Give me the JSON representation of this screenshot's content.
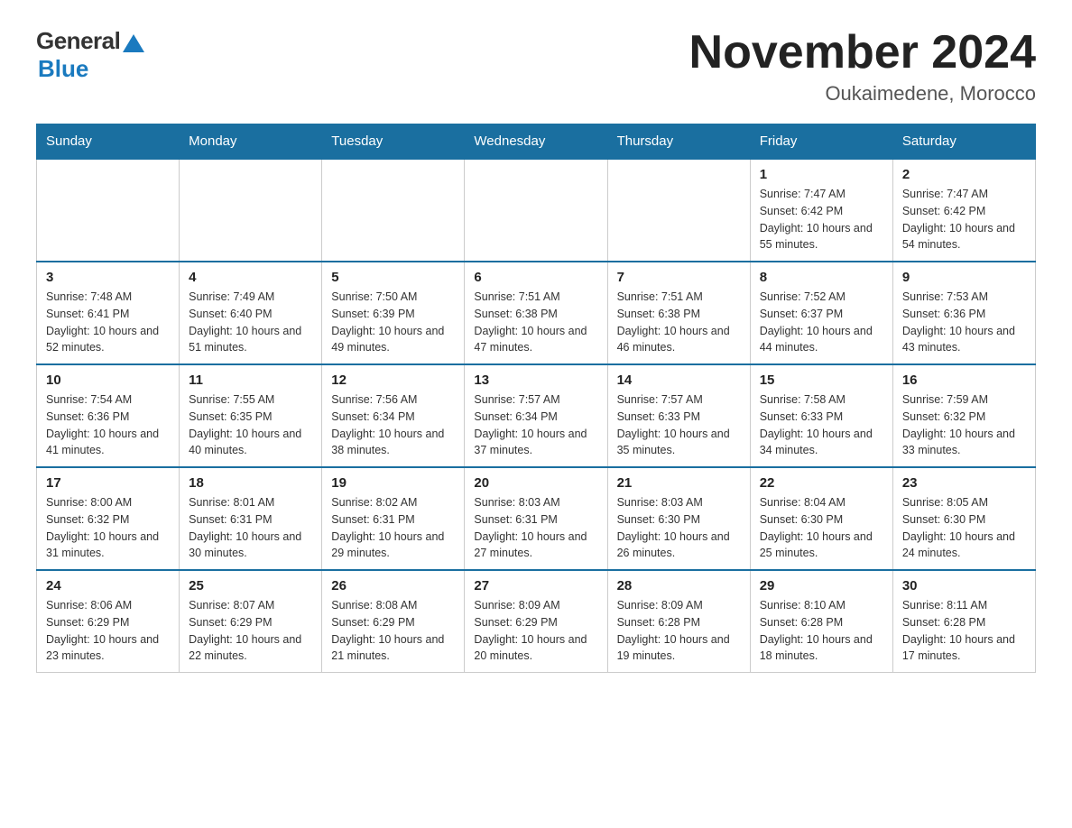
{
  "header": {
    "logo_general": "General",
    "logo_blue": "Blue",
    "month_title": "November 2024",
    "location": "Oukaimedene, Morocco"
  },
  "weekdays": [
    "Sunday",
    "Monday",
    "Tuesday",
    "Wednesday",
    "Thursday",
    "Friday",
    "Saturday"
  ],
  "weeks": [
    [
      {
        "day": "",
        "info": ""
      },
      {
        "day": "",
        "info": ""
      },
      {
        "day": "",
        "info": ""
      },
      {
        "day": "",
        "info": ""
      },
      {
        "day": "",
        "info": ""
      },
      {
        "day": "1",
        "info": "Sunrise: 7:47 AM\nSunset: 6:42 PM\nDaylight: 10 hours and 55 minutes."
      },
      {
        "day": "2",
        "info": "Sunrise: 7:47 AM\nSunset: 6:42 PM\nDaylight: 10 hours and 54 minutes."
      }
    ],
    [
      {
        "day": "3",
        "info": "Sunrise: 7:48 AM\nSunset: 6:41 PM\nDaylight: 10 hours and 52 minutes."
      },
      {
        "day": "4",
        "info": "Sunrise: 7:49 AM\nSunset: 6:40 PM\nDaylight: 10 hours and 51 minutes."
      },
      {
        "day": "5",
        "info": "Sunrise: 7:50 AM\nSunset: 6:39 PM\nDaylight: 10 hours and 49 minutes."
      },
      {
        "day": "6",
        "info": "Sunrise: 7:51 AM\nSunset: 6:38 PM\nDaylight: 10 hours and 47 minutes."
      },
      {
        "day": "7",
        "info": "Sunrise: 7:51 AM\nSunset: 6:38 PM\nDaylight: 10 hours and 46 minutes."
      },
      {
        "day": "8",
        "info": "Sunrise: 7:52 AM\nSunset: 6:37 PM\nDaylight: 10 hours and 44 minutes."
      },
      {
        "day": "9",
        "info": "Sunrise: 7:53 AM\nSunset: 6:36 PM\nDaylight: 10 hours and 43 minutes."
      }
    ],
    [
      {
        "day": "10",
        "info": "Sunrise: 7:54 AM\nSunset: 6:36 PM\nDaylight: 10 hours and 41 minutes."
      },
      {
        "day": "11",
        "info": "Sunrise: 7:55 AM\nSunset: 6:35 PM\nDaylight: 10 hours and 40 minutes."
      },
      {
        "day": "12",
        "info": "Sunrise: 7:56 AM\nSunset: 6:34 PM\nDaylight: 10 hours and 38 minutes."
      },
      {
        "day": "13",
        "info": "Sunrise: 7:57 AM\nSunset: 6:34 PM\nDaylight: 10 hours and 37 minutes."
      },
      {
        "day": "14",
        "info": "Sunrise: 7:57 AM\nSunset: 6:33 PM\nDaylight: 10 hours and 35 minutes."
      },
      {
        "day": "15",
        "info": "Sunrise: 7:58 AM\nSunset: 6:33 PM\nDaylight: 10 hours and 34 minutes."
      },
      {
        "day": "16",
        "info": "Sunrise: 7:59 AM\nSunset: 6:32 PM\nDaylight: 10 hours and 33 minutes."
      }
    ],
    [
      {
        "day": "17",
        "info": "Sunrise: 8:00 AM\nSunset: 6:32 PM\nDaylight: 10 hours and 31 minutes."
      },
      {
        "day": "18",
        "info": "Sunrise: 8:01 AM\nSunset: 6:31 PM\nDaylight: 10 hours and 30 minutes."
      },
      {
        "day": "19",
        "info": "Sunrise: 8:02 AM\nSunset: 6:31 PM\nDaylight: 10 hours and 29 minutes."
      },
      {
        "day": "20",
        "info": "Sunrise: 8:03 AM\nSunset: 6:31 PM\nDaylight: 10 hours and 27 minutes."
      },
      {
        "day": "21",
        "info": "Sunrise: 8:03 AM\nSunset: 6:30 PM\nDaylight: 10 hours and 26 minutes."
      },
      {
        "day": "22",
        "info": "Sunrise: 8:04 AM\nSunset: 6:30 PM\nDaylight: 10 hours and 25 minutes."
      },
      {
        "day": "23",
        "info": "Sunrise: 8:05 AM\nSunset: 6:30 PM\nDaylight: 10 hours and 24 minutes."
      }
    ],
    [
      {
        "day": "24",
        "info": "Sunrise: 8:06 AM\nSunset: 6:29 PM\nDaylight: 10 hours and 23 minutes."
      },
      {
        "day": "25",
        "info": "Sunrise: 8:07 AM\nSunset: 6:29 PM\nDaylight: 10 hours and 22 minutes."
      },
      {
        "day": "26",
        "info": "Sunrise: 8:08 AM\nSunset: 6:29 PM\nDaylight: 10 hours and 21 minutes."
      },
      {
        "day": "27",
        "info": "Sunrise: 8:09 AM\nSunset: 6:29 PM\nDaylight: 10 hours and 20 minutes."
      },
      {
        "day": "28",
        "info": "Sunrise: 8:09 AM\nSunset: 6:28 PM\nDaylight: 10 hours and 19 minutes."
      },
      {
        "day": "29",
        "info": "Sunrise: 8:10 AM\nSunset: 6:28 PM\nDaylight: 10 hours and 18 minutes."
      },
      {
        "day": "30",
        "info": "Sunrise: 8:11 AM\nSunset: 6:28 PM\nDaylight: 10 hours and 17 minutes."
      }
    ]
  ]
}
